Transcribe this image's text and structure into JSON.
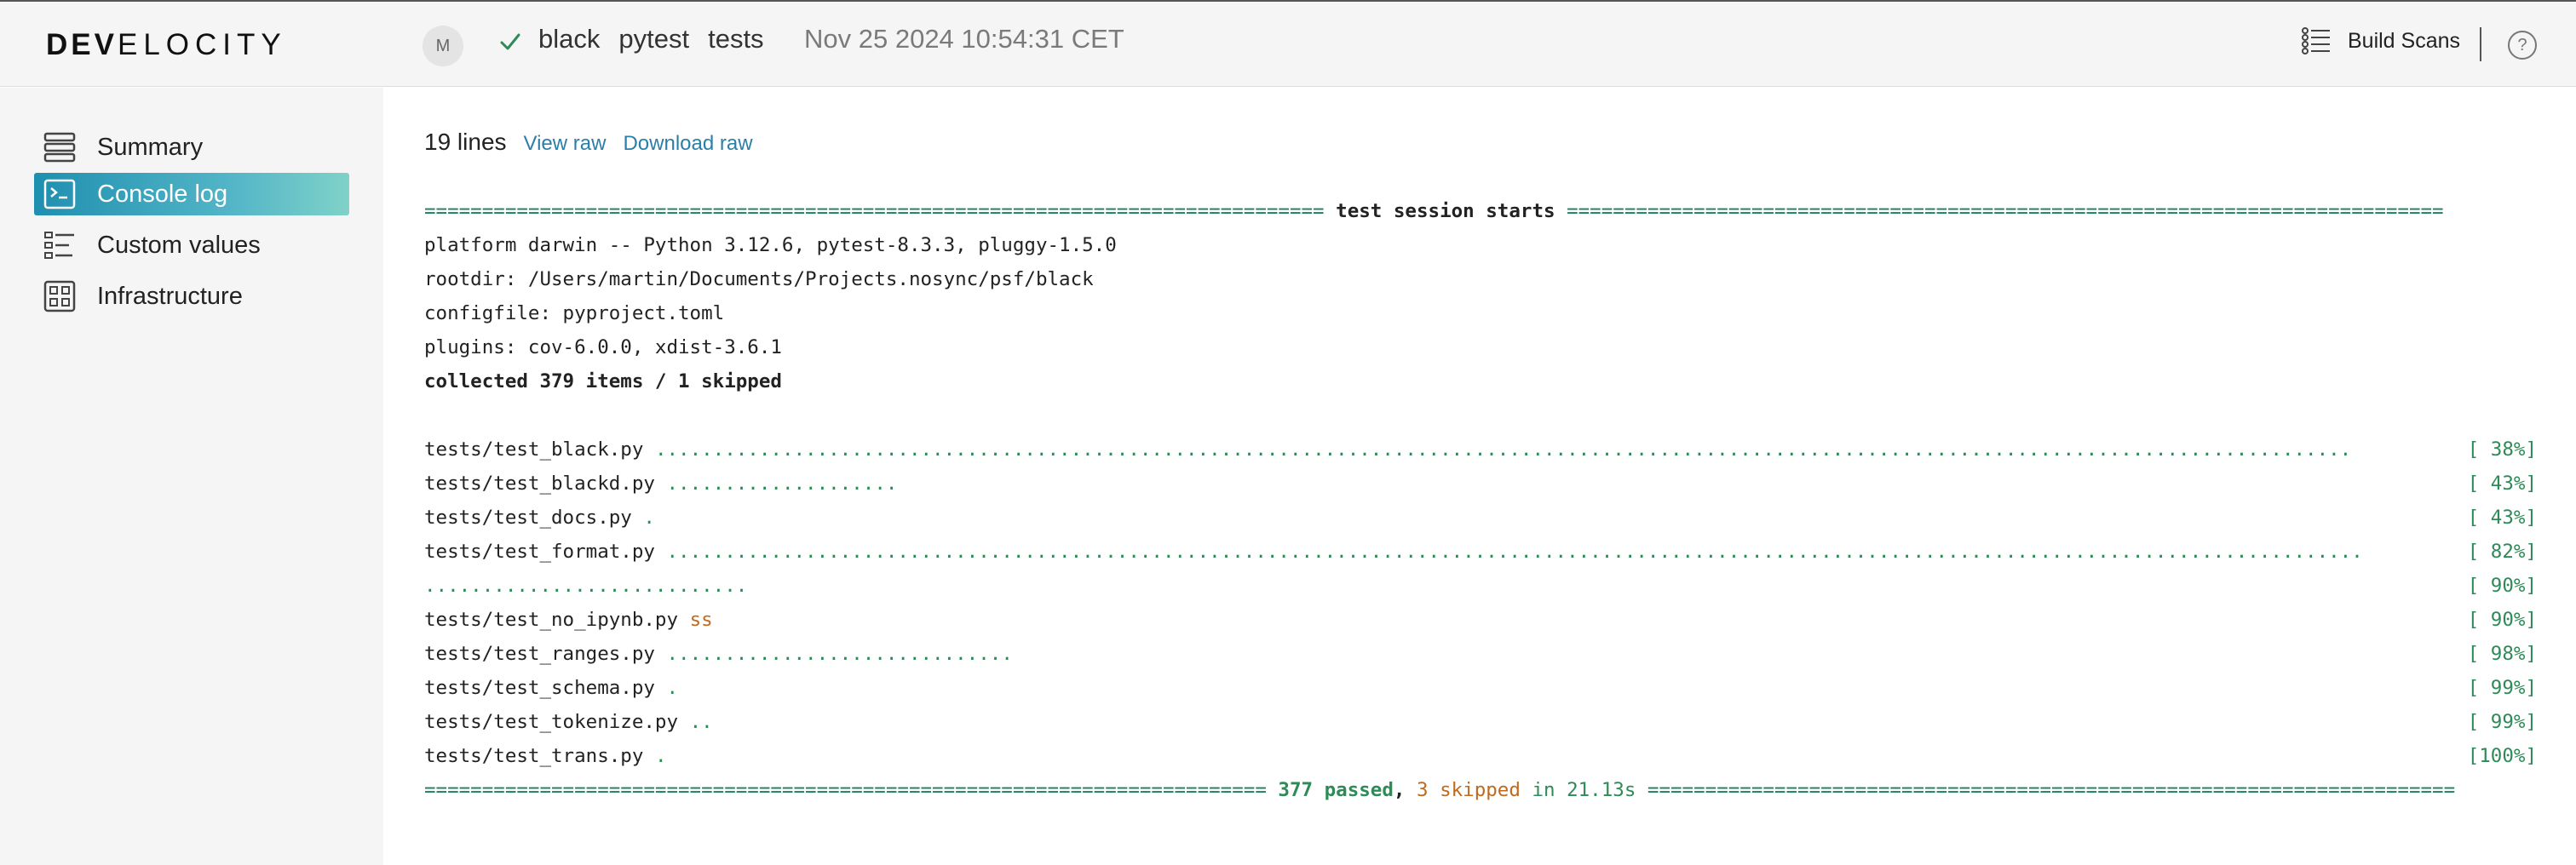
{
  "header": {
    "logo_bold": "DEV",
    "logo_rest": "ELOCITY",
    "avatar_initial": "M",
    "tags": [
      "black",
      "pytest",
      "tests"
    ],
    "timestamp": "Nov 25 2024 10:54:31 CET",
    "build_scans_label": "Build Scans",
    "help_label": "?"
  },
  "sidebar": {
    "items": [
      {
        "label": "Summary",
        "icon": "summary-icon",
        "active": false
      },
      {
        "label": "Console log",
        "icon": "console-icon",
        "active": true
      },
      {
        "label": "Custom values",
        "icon": "custom-values-icon",
        "active": false
      },
      {
        "label": "Infrastructure",
        "icon": "infrastructure-icon",
        "active": false
      }
    ]
  },
  "main": {
    "lines_count": "19 lines",
    "view_raw": "View raw",
    "download_raw": "Download raw"
  },
  "console": {
    "session_sep_left": "==============================================================================",
    "session_title": "test session starts",
    "session_sep_right": "============================================================================",
    "platform": "platform darwin -- Python 3.12.6, pytest-8.3.3, pluggy-1.5.0",
    "rootdir": "rootdir: /Users/martin/Documents/Projects.nosync/psf/black",
    "configfile": "configfile: pyproject.toml",
    "plugins": "plugins: cov-6.0.0, xdist-3.6.1",
    "collected": "collected 379 items / 1 skipped",
    "results": [
      {
        "file": "tests/test_black.py ",
        "dots": "...................................................................................................................................................",
        "skips": "",
        "pct": "[ 38%]"
      },
      {
        "file": "tests/test_blackd.py ",
        "dots": "....................",
        "skips": "",
        "pct": "[ 43%]"
      },
      {
        "file": "tests/test_docs.py ",
        "dots": ".",
        "skips": "",
        "pct": "[ 43%]"
      },
      {
        "file": "tests/test_format.py ",
        "dots": "...................................................................................................................................................",
        "skips": "",
        "pct": "[ 82%]"
      },
      {
        "file": "",
        "dots": "............................",
        "skips": "",
        "pct": "[ 90%]"
      },
      {
        "file": "tests/test_no_ipynb.py ",
        "dots": "",
        "skips": "ss",
        "pct": "[ 90%]"
      },
      {
        "file": "tests/test_ranges.py ",
        "dots": "..............................",
        "skips": "",
        "pct": "[ 98%]"
      },
      {
        "file": "tests/test_schema.py ",
        "dots": ".",
        "skips": "",
        "pct": "[ 99%]"
      },
      {
        "file": "tests/test_tokenize.py ",
        "dots": "..",
        "skips": "",
        "pct": "[ 99%]"
      },
      {
        "file": "tests/test_trans.py ",
        "dots": ".",
        "skips": "",
        "pct": "[100%]"
      }
    ],
    "summary_sep_left": "=========================================================================",
    "summary_passed": "377 passed",
    "summary_comma": ",",
    "summary_skipped": "3 skipped",
    "summary_time": "in 21.13s",
    "summary_sep_right": "======================================================================"
  }
}
